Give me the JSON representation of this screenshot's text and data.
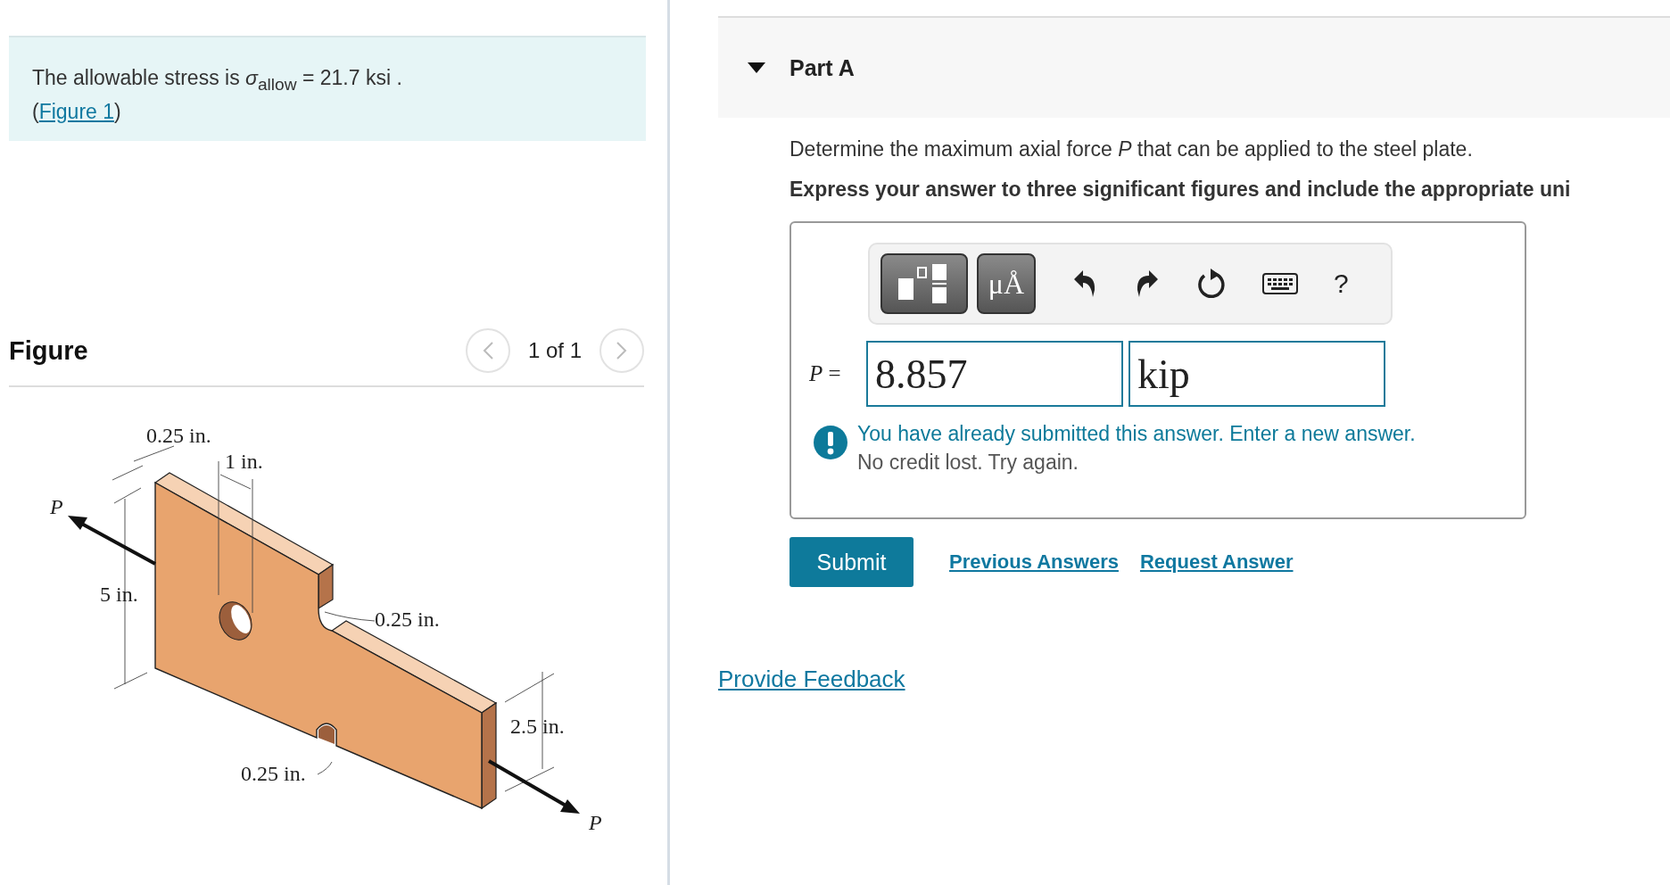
{
  "problem": {
    "statement": "The allowable stress is *σ*$_{allow}$ = 21.7 ksi .",
    "ref_open": "(",
    "ref_link": "Figure 1",
    "ref_close": ")"
  },
  "figure": {
    "heading": "Figure",
    "pager": "1 of 1",
    "labels": [
      "0.25 in.",
      "1 in.",
      "5 in.",
      "0.25 in.",
      "2.5 in.",
      "0.25 in.",
      "P",
      "P"
    ]
  },
  "part": {
    "title": "Part A",
    "expanded": true,
    "question": "Determine the maximum axial force *P* that can be applied to the steel plate.",
    "instruction": "Express your answer to three significant figures and include the appropriate uni",
    "toolbar": {
      "units_button": "μÅ",
      "help": "?"
    },
    "answer": {
      "variable": "P",
      "equals": "=",
      "value": "8.857",
      "unit": "kip"
    },
    "message": {
      "kind": "warning",
      "headline": "You have already submitted this answer. Enter a new answer.",
      "detail": "No credit lost. Try again."
    },
    "submit": "Submit",
    "links": [
      "Previous Answers",
      "Request Answer"
    ]
  },
  "feedback_link": "Provide Feedback"
}
